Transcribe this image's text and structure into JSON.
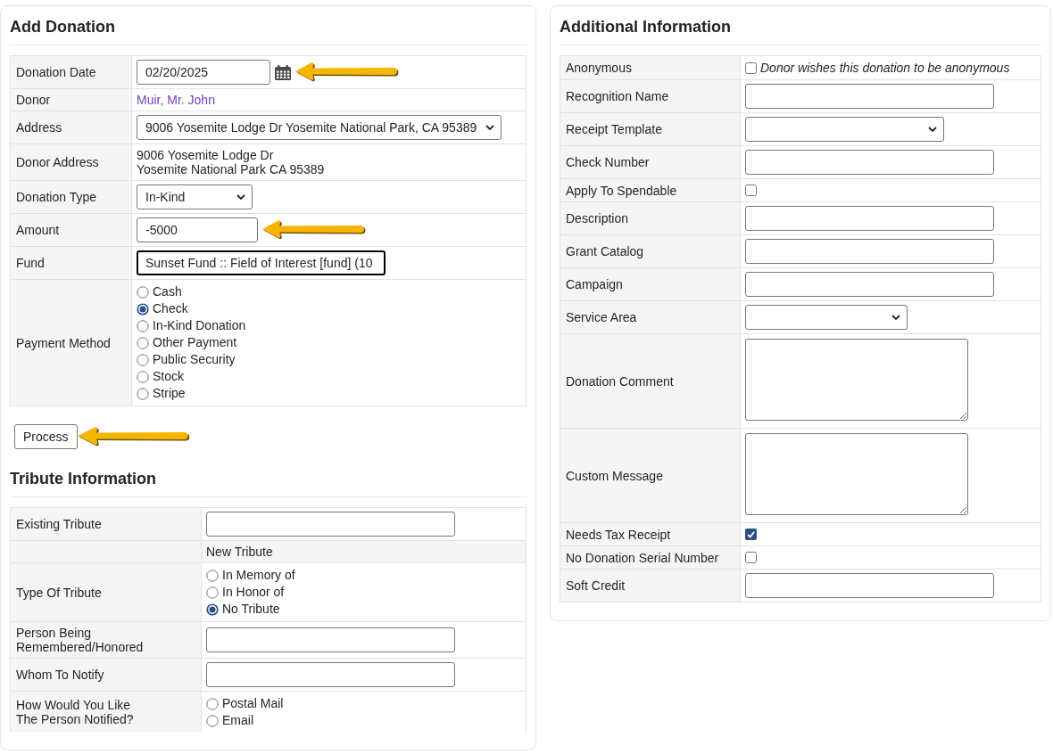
{
  "add_donation": {
    "title": "Add Donation",
    "fields": [
      {
        "kind": "date",
        "label": "Donation Date",
        "value": "02/20/2025",
        "focused": false,
        "arrow": true
      },
      {
        "kind": "link",
        "label": "Donor",
        "value": "Muir, Mr. John",
        "arrow": false
      },
      {
        "kind": "select",
        "label": "Address",
        "value": "9006 Yosemite Lodge Dr Yosemite National Park, CA 95389",
        "focused": false,
        "arrow": false
      },
      {
        "kind": "text",
        "label": "Donor Address",
        "value": "9006 Yosemite Lodge Dr\nYosemite National Park CA 95389",
        "arrow": false
      },
      {
        "kind": "select",
        "label": "Donation Type",
        "value": "In-Kind",
        "focused": false,
        "arrow": false
      },
      {
        "kind": "input",
        "label": "Amount",
        "value": "-5000",
        "focused": false,
        "arrow": true
      },
      {
        "kind": "lookup",
        "label": "Fund",
        "value": "Sunset Fund :: Field of Interest [fund] (10",
        "focused": true,
        "arrow": false
      },
      {
        "kind": "radio",
        "label": "Payment Method",
        "arrow": false,
        "options": [
          {
            "label": "Cash",
            "selected": false
          },
          {
            "label": "Check",
            "selected": true
          },
          {
            "label": "In-Kind Donation",
            "selected": false
          },
          {
            "label": "Other Payment",
            "selected": false
          },
          {
            "label": "Public Security",
            "selected": false
          },
          {
            "label": "Stock",
            "selected": false
          },
          {
            "label": "Stripe",
            "selected": false
          }
        ]
      }
    ],
    "process_button": {
      "label": "Process",
      "arrow": true
    }
  },
  "tribute_information": {
    "title": "Tribute Information",
    "fields": [
      {
        "kind": "input",
        "label": "Existing Tribute"
      },
      {
        "kind": "subheading",
        "text": "New Tribute"
      },
      {
        "kind": "radio",
        "label": "Type Of Tribute",
        "options": [
          {
            "label": "In Memory of",
            "selected": false
          },
          {
            "label": "In Honor of",
            "selected": false
          },
          {
            "label": "No Tribute",
            "selected": true
          }
        ]
      },
      {
        "kind": "input",
        "label": "Person Being\nRemembered/Honored"
      },
      {
        "kind": "input",
        "label": "Whom To Notify"
      },
      {
        "kind": "radio",
        "label": "How Would You Like\nThe Person Notified?",
        "options": [
          {
            "label": "Postal Mail",
            "selected": false
          },
          {
            "label": "Email",
            "selected": false
          }
        ]
      }
    ]
  },
  "additional_information": {
    "title": "Additional Information",
    "fields": [
      {
        "kind": "checkbox",
        "label": "Anonymous",
        "checked": false,
        "text": "Donor wishes this donation to be anonymous"
      },
      {
        "kind": "input",
        "label": "Recognition Name"
      },
      {
        "kind": "select",
        "label": "Receipt Template"
      },
      {
        "kind": "input",
        "label": "Check Number"
      },
      {
        "kind": "checkbox",
        "label": "Apply To Spendable",
        "checked": false
      },
      {
        "kind": "input",
        "label": "Description"
      },
      {
        "kind": "input",
        "label": "Grant Catalog"
      },
      {
        "kind": "input",
        "label": "Campaign"
      },
      {
        "kind": "select",
        "label": "Service Area"
      },
      {
        "kind": "textarea",
        "label": "Donation Comment"
      },
      {
        "kind": "textarea",
        "label": "Custom Message"
      },
      {
        "kind": "checkbox",
        "label": "Needs Tax Receipt",
        "checked": true
      },
      {
        "kind": "checkbox",
        "label": "No Donation Serial Number",
        "checked": false
      },
      {
        "kind": "input",
        "label": "Soft Credit"
      }
    ]
  }
}
